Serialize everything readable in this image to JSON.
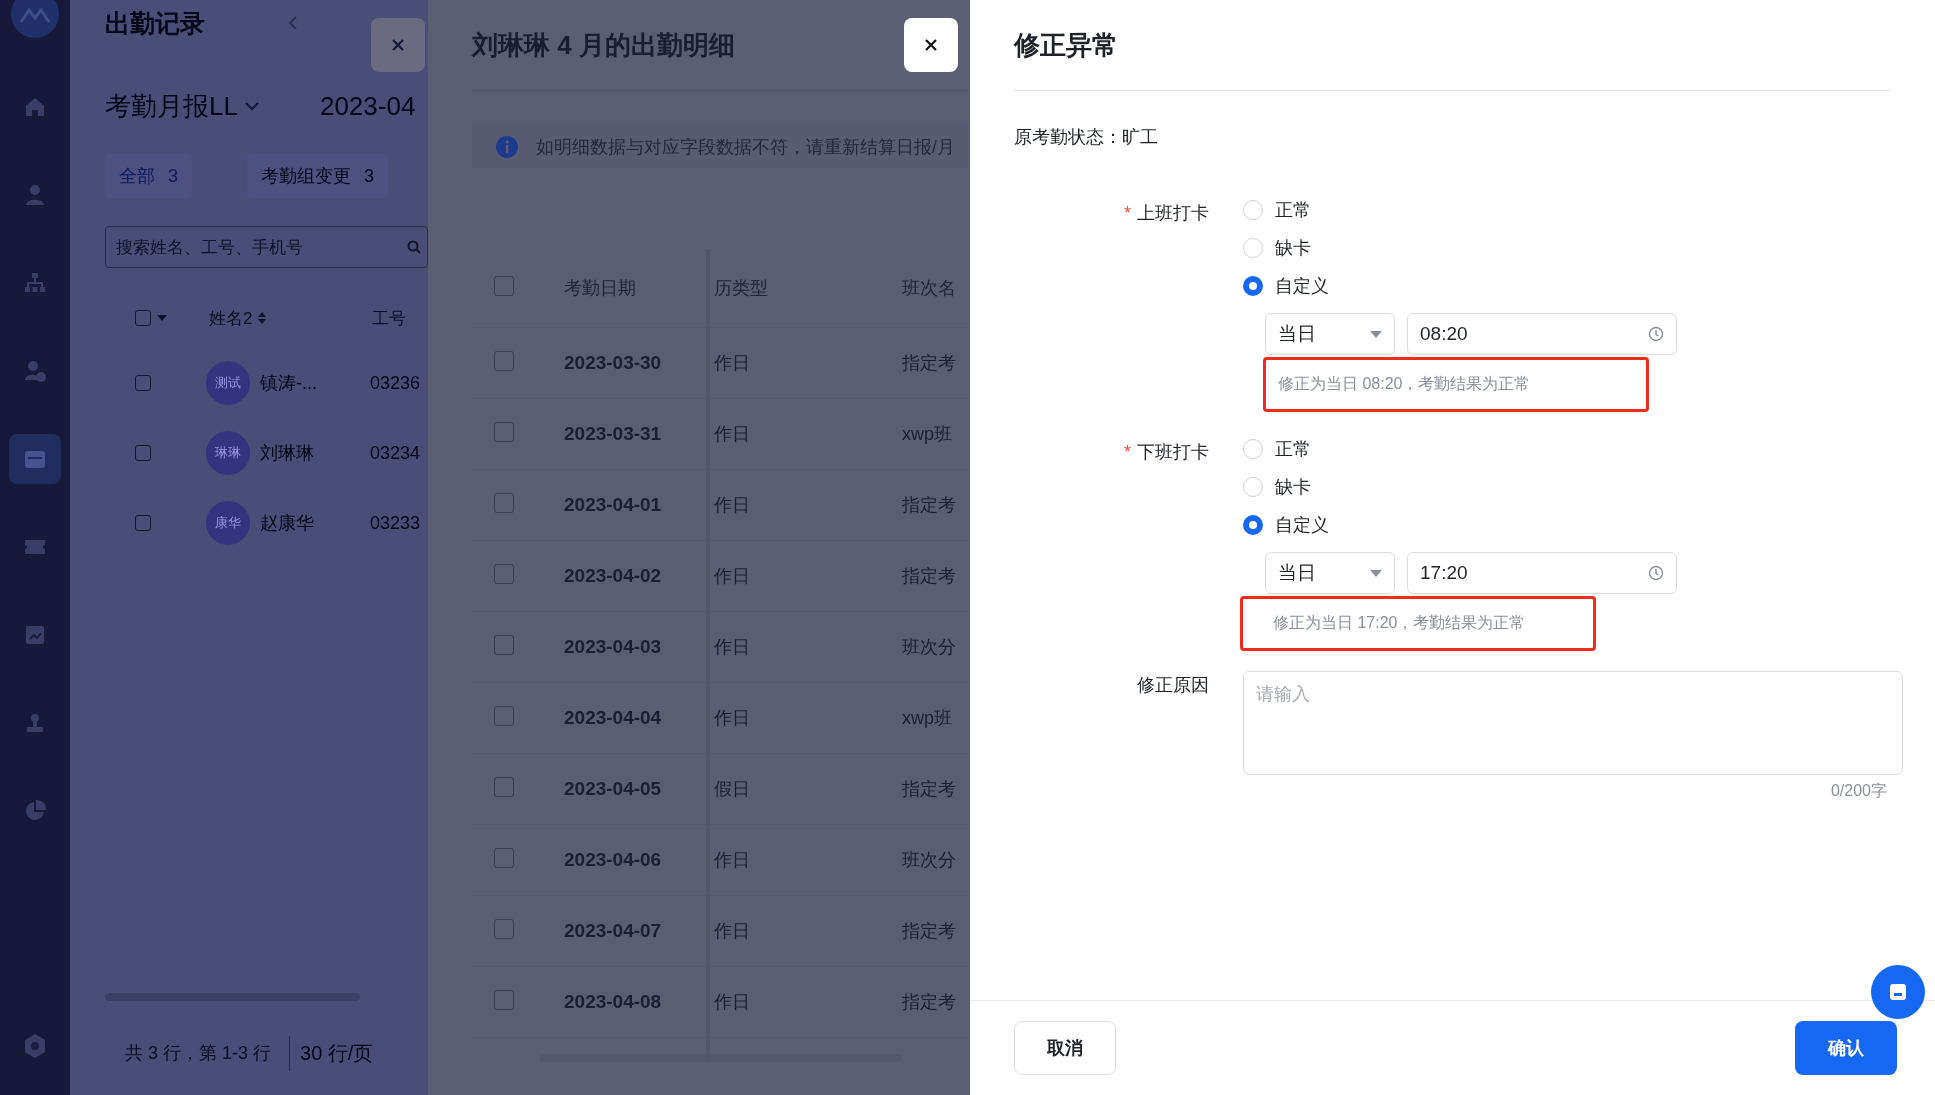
{
  "sidebar": {
    "items": [
      {
        "selected": false
      },
      {
        "selected": false
      },
      {
        "selected": false
      },
      {
        "selected": false
      },
      {
        "selected": true
      },
      {
        "selected": false
      },
      {
        "selected": false
      },
      {
        "selected": false
      },
      {
        "selected": false
      }
    ]
  },
  "background_page": {
    "title": "出勤记录",
    "report_select": "考勤月报LL",
    "date": "2023-04",
    "tabs": [
      {
        "label": "全部",
        "count": "3",
        "selected": true
      },
      {
        "label": "考勤组变更",
        "count": "3",
        "selected": false
      }
    ],
    "search": {
      "placeholder": "搜索姓名、工号、手机号"
    },
    "select_all_checked": false,
    "columns": [
      "姓名2",
      "工号"
    ],
    "rows": [
      {
        "avatar": "测试",
        "name": "镇涛-...",
        "id": "03236",
        "checked": false
      },
      {
        "avatar": "琳琳",
        "name": "刘琳琳",
        "id": "03234",
        "checked": false
      },
      {
        "avatar": "康华",
        "name": "赵康华",
        "id": "03233",
        "checked": false
      }
    ],
    "footer": {
      "summary": "共 3 行，第 1-3 行",
      "page_size": "30 行/页"
    }
  },
  "detail_drawer": {
    "title": "刘琳琳 4 月的出勤明细",
    "notice": "如明细数据与对应字段数据不符，请重新结算日报/月",
    "columns": [
      "考勤日期",
      "历类型",
      "班次名"
    ],
    "select_all_checked": false,
    "rows": [
      {
        "date": "2023-03-30",
        "day_type": "作日",
        "shift": "指定考",
        "checked": false
      },
      {
        "date": "2023-03-31",
        "day_type": "作日",
        "shift": "xwp班",
        "checked": false
      },
      {
        "date": "2023-04-01",
        "day_type": "作日",
        "shift": "指定考",
        "checked": false
      },
      {
        "date": "2023-04-02",
        "day_type": "作日",
        "shift": "指定考",
        "checked": false
      },
      {
        "date": "2023-04-03",
        "day_type": "作日",
        "shift": "班次分",
        "checked": false
      },
      {
        "date": "2023-04-04",
        "day_type": "作日",
        "shift": "xwp班",
        "checked": false
      },
      {
        "date": "2023-04-05",
        "day_type": "假日",
        "shift": "指定考",
        "checked": false
      },
      {
        "date": "2023-04-06",
        "day_type": "作日",
        "shift": "班次分",
        "checked": false
      },
      {
        "date": "2023-04-07",
        "day_type": "作日",
        "shift": "指定考",
        "checked": false
      },
      {
        "date": "2023-04-08",
        "day_type": "作日",
        "shift": "指定考",
        "checked": false
      }
    ]
  },
  "correction": {
    "title": "修正异常",
    "original_status_label": "原考勤状态：",
    "original_status": "旷工",
    "punches": [
      {
        "label": "上班打卡",
        "required_mark": "*",
        "options": [
          {
            "label": "正常",
            "selected": false
          },
          {
            "label": "缺卡",
            "selected": false
          },
          {
            "label": "自定义",
            "selected": true
          }
        ],
        "day": "当日",
        "time": "08:20",
        "hint": "修正为当日 08:20，考勤结果为正常",
        "highlighted": true
      },
      {
        "label": "下班打卡",
        "required_mark": "*",
        "options": [
          {
            "label": "正常",
            "selected": false
          },
          {
            "label": "缺卡",
            "selected": false
          },
          {
            "label": "自定义",
            "selected": true
          }
        ],
        "day": "当日",
        "time": "17:20",
        "hint": "修正为当日 17:20，考勤结果为正常",
        "highlighted": true
      }
    ],
    "reason": {
      "label": "修正原因",
      "placeholder": "请输入",
      "counter": "0/200字"
    },
    "buttons": {
      "cancel": "取消",
      "confirm": "确认"
    }
  }
}
